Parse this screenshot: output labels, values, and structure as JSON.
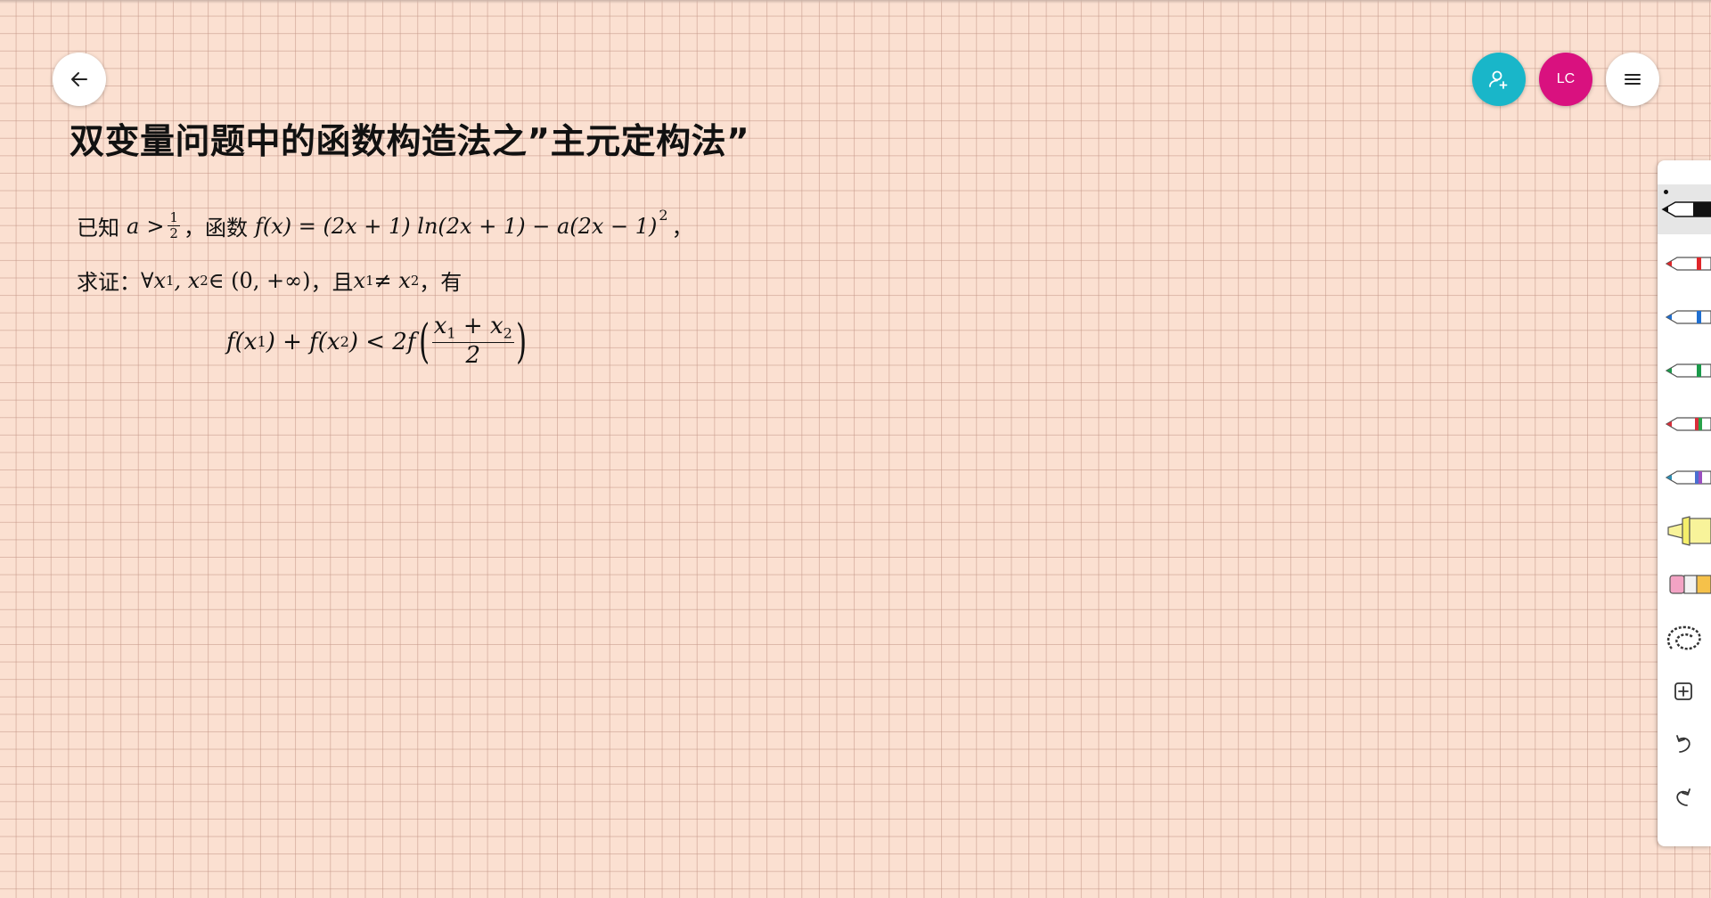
{
  "header": {
    "share_icon": "add-person-icon",
    "avatar_initials": "LC",
    "back_icon": "arrow-left-icon",
    "menu_icon": "hamburger-menu-icon"
  },
  "document": {
    "title": "双变量问题中的函数构造法之”主元定构法”",
    "line1": {
      "prefix": "已知",
      "a": "a",
      "gt": ">",
      "half_num": "1",
      "half_den": "2",
      "comma1": "，",
      "func_label": "函数",
      "f_def": "f(x) = (2x + 1) ln(2x + 1) − a(2x − 1)",
      "exp": "2",
      "comma2": "，"
    },
    "line2": {
      "label": "求证：",
      "forall_part": "∀x",
      "sub1": "1",
      "comma": ", x",
      "sub2": "2",
      "domain": " ∈ (0, +∞)",
      "and_label": "，且",
      "x1": "x",
      "x1_sub": "1",
      "neq": " ≠ x",
      "x2_sub": "2",
      "tail": "，有"
    },
    "formula": {
      "lhs": "f(x",
      "lhs_sub1": "1",
      "mid": ") + f(x",
      "lhs_sub2": "2",
      "rhs": ") < 2f",
      "frac_num_a": "x",
      "frac_num_sub1": "1",
      "frac_num_plus": " + x",
      "frac_num_sub2": "2",
      "frac_den": "2"
    }
  },
  "toolbar": {
    "tools": [
      {
        "name": "black-pen-tool",
        "color": "#111111",
        "active": true
      },
      {
        "name": "red-pen-tool",
        "color": "#e0262a"
      },
      {
        "name": "blue-pen-tool",
        "color": "#1f6fd1"
      },
      {
        "name": "green-pen-tool",
        "color": "#1a9a4a"
      },
      {
        "name": "multicolor-red-pen-tool",
        "color": "#d82e3a"
      },
      {
        "name": "galaxy-pen-tool",
        "color": "#6b4fb8"
      },
      {
        "name": "highlighter-tool",
        "color": "#f5ef6a"
      },
      {
        "name": "eraser-tool",
        "color": "#f3a3c4"
      },
      {
        "name": "lasso-select-tool",
        "color": "#333333"
      },
      {
        "name": "add-shape-tool",
        "color": "#333333"
      },
      {
        "name": "undo-tool",
        "color": "#333333"
      },
      {
        "name": "redo-tool",
        "color": "#333333"
      }
    ]
  }
}
